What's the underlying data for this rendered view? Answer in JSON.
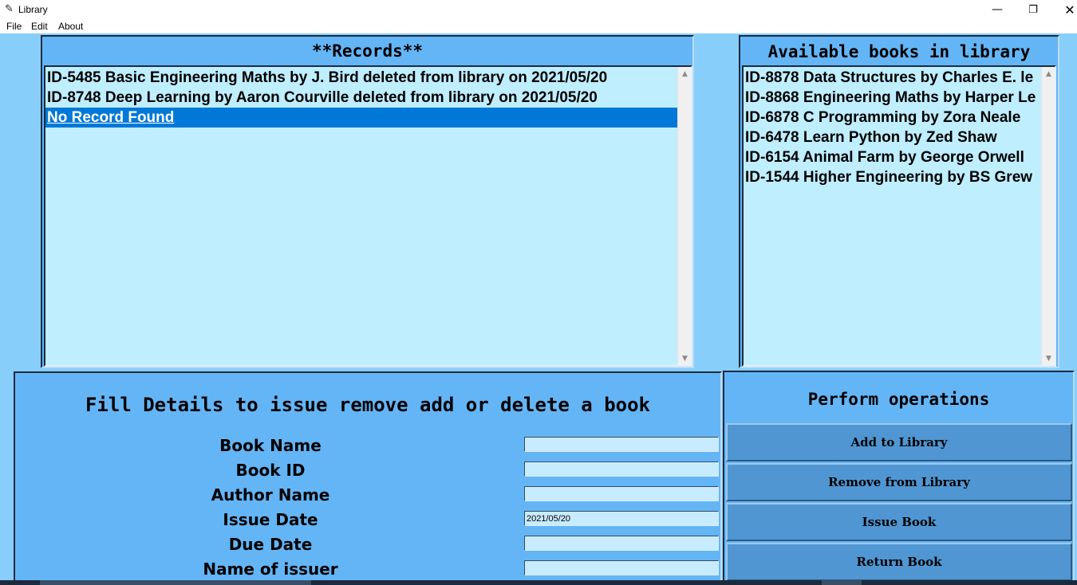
{
  "window": {
    "title": "Library",
    "icon": "feather-icon",
    "controls": {
      "minimize": "—",
      "maximize": "❐",
      "close": "✕"
    }
  },
  "menu": {
    "items": [
      "File",
      "Edit",
      "About"
    ]
  },
  "records": {
    "heading": "**Records**",
    "items": [
      "ID-5485 Basic Engineering Maths by J. Bird deleted from library on 2021/05/20",
      "ID-8748 Deep Learning by Aaron Courville deleted from library on 2021/05/20",
      "No Record Found"
    ],
    "selected_index": 2
  },
  "books": {
    "heading": "Available books in library",
    "items": [
      "ID-8878 Data Structures by Charles E. le",
      "ID-8868 Engineering Maths by Harper Le",
      "ID-6878 C Programming by Zora Neale",
      "ID-6478 Learn Python by Zed Shaw",
      "ID-6154 Animal Farm by George Orwell",
      "ID-1544 Higher Engineering by BS Grew"
    ]
  },
  "form": {
    "heading": "Fill Details to issue remove add or delete a book",
    "fields": [
      {
        "label": "Book Name",
        "value": ""
      },
      {
        "label": "Book ID",
        "value": ""
      },
      {
        "label": "Author Name",
        "value": ""
      },
      {
        "label": "Issue Date",
        "value": "2021/05/20"
      },
      {
        "label": "Due Date",
        "value": ""
      },
      {
        "label": "Name of issuer",
        "value": ""
      }
    ]
  },
  "operations": {
    "heading": "Perform operations",
    "buttons": [
      "Add to Library",
      "Remove from Library",
      "Issue Book",
      "Return Book"
    ]
  },
  "colors": {
    "background": "#87cefa",
    "panel": "#64b5f6",
    "listbox": "#bfeeff",
    "selection": "#0078d7",
    "button": "#5096d2"
  }
}
